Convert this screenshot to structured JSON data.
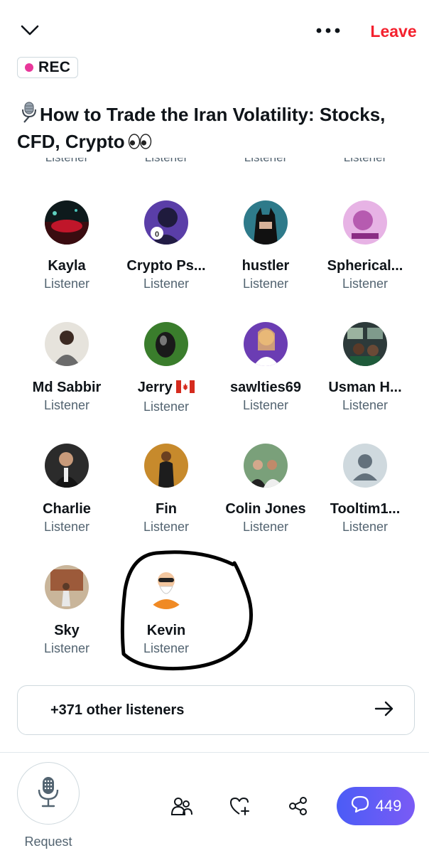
{
  "header": {
    "leave_label": "Leave"
  },
  "rec": {
    "label": "REC"
  },
  "space_title": "How to Trade the Iran Volatility: Stocks, CFD, Crypto",
  "clipped_role": "Listener",
  "people": [
    {
      "name": "Kayla",
      "role": "Listener"
    },
    {
      "name": "Crypto Ps...",
      "role": "Listener"
    },
    {
      "name": "hustler",
      "role": "Listener"
    },
    {
      "name": "Spherical...",
      "role": "Listener"
    },
    {
      "name": "Md Sabbir",
      "role": "Listener"
    },
    {
      "name": "Jerry",
      "role": "Listener"
    },
    {
      "name": "sawlties69",
      "role": "Listener"
    },
    {
      "name": "Usman H...",
      "role": "Listener"
    },
    {
      "name": "Charlie",
      "role": "Listener"
    },
    {
      "name": "Fin",
      "role": "Listener"
    },
    {
      "name": "Colin Jones",
      "role": "Listener"
    },
    {
      "name": "Tooltim1...",
      "role": "Listener"
    },
    {
      "name": "Sky",
      "role": "Listener"
    },
    {
      "name": "Kevin",
      "role": "Listener"
    }
  ],
  "other_listeners": "+371 other listeners",
  "bottom": {
    "request_label": "Request",
    "chat_count": "449"
  },
  "colors": {
    "leave": "#f4212e",
    "rec_dot": "#e8379a",
    "chat_gradient_start": "#4b5cf6",
    "chat_gradient_end": "#7a5bf5"
  }
}
